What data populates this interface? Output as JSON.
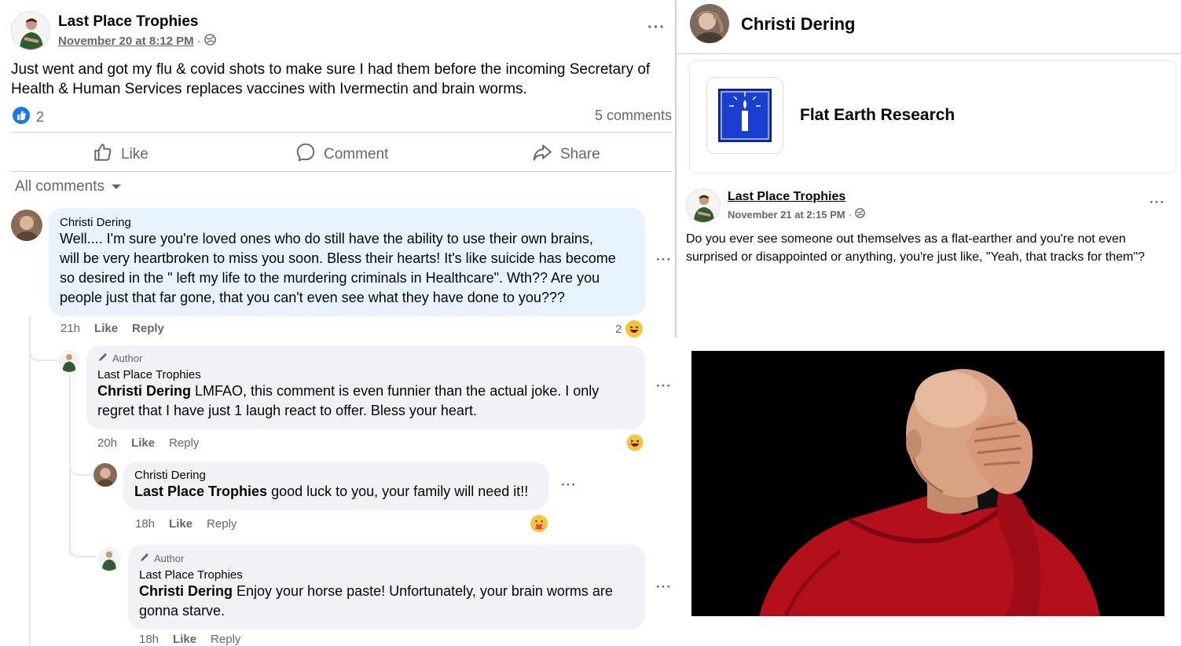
{
  "post": {
    "author": "Last Place Trophies",
    "timestamp": "November 20 at 8:12 PM",
    "separator": "·",
    "text_line1": "Just went and got my flu & covid shots to make sure I had them before the incoming Secretary of",
    "text_line2": "Health & Human Services replaces vaccines with Ivermectin and brain worms.",
    "reaction_count": "2",
    "comment_count": "5 comments",
    "actions": {
      "like": "Like",
      "comment": "Comment",
      "share": "Share"
    },
    "comments_filter": "All comments"
  },
  "comments": [
    {
      "name": "Christi Dering",
      "lines": [
        "Well.... I'm sure you're loved ones who do still have the ability to use their own brains,",
        "will be very heartbroken to miss you soon. Bless their hearts! It's like suicide has become",
        "so desired in the \" left my life to the murdering criminals in Healthcare\". Wth?? Are you",
        "people just that far gone, that you can't even see what they have done to you???"
      ],
      "time": "21h",
      "like": "Like",
      "reply": "Reply",
      "reaction_count": "2"
    },
    {
      "badge": "Author",
      "name": "Last Place Trophies",
      "tag": "Christi Dering",
      "line1": " LMFAO, this comment is even funnier than the actual joke. I only",
      "line2": "regret that I have just 1 laugh react to offer. Bless your heart.",
      "time": "20h",
      "like": "Like",
      "reply": "Reply"
    },
    {
      "name": "Christi Dering",
      "tag": "Last Place Trophies",
      "line1": " good luck to you, your family will need it!!",
      "time": "18h",
      "like": "Like",
      "reply": "Reply"
    },
    {
      "badge": "Author",
      "name": "Last Place Trophies",
      "tag": "Christi Dering",
      "line1": " Enjoy your horse paste! Unfortunately, your brain worms are",
      "line2": "gonna starve.",
      "time": "18h",
      "like": "Like",
      "reply": "Reply"
    }
  ],
  "profile": {
    "name": "Christi Dering",
    "group": "Flat Earth Research"
  },
  "post2": {
    "author": "Last Place Trophies",
    "timestamp": "November 21 at 2:15 PM",
    "separator": "·",
    "text_line1": "Do you ever see someone out themselves as a flat-earther and you're not even",
    "text_line2": "surprised or disappointed or anything, you're just like, \"Yeah, that tracks for them\"?"
  },
  "colors": {
    "like_blue": "#1877f2",
    "comment_bubble_highlight": "#e7f3ff",
    "comment_bubble": "#f0f2f5",
    "meme_background": "#000000",
    "uniform_red": "#b3101c"
  }
}
